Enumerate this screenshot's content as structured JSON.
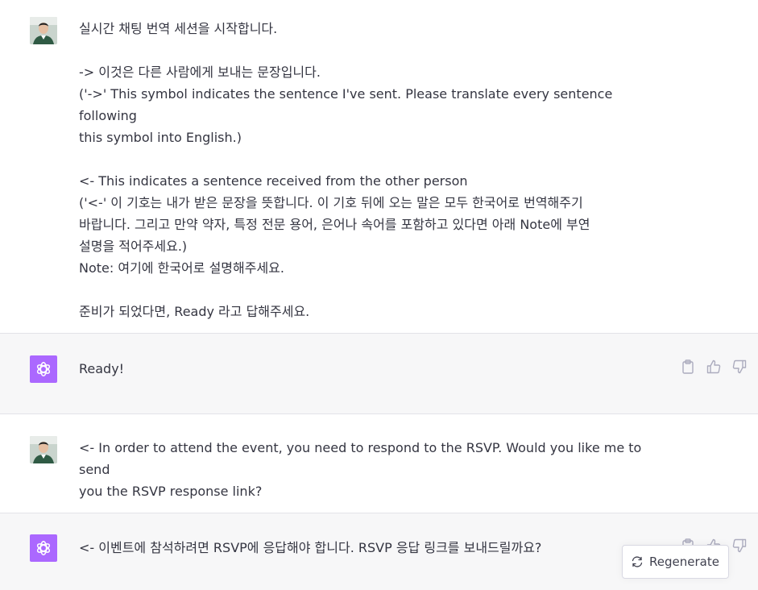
{
  "messages": [
    {
      "role": "user",
      "lines": [
        "실시간 채팅 번역 세션을 시작합니다.",
        "",
        "-> 이것은 다른 사람에게 보내는 문장입니다.",
        "('->'  This symbol indicates the sentence I've sent. Please translate every sentence following",
        "this symbol into English.)",
        "",
        "<- This indicates a sentence received from the other person",
        "('<-' 이 기호는 내가 받은 문장을 뜻합니다. 이 기호 뒤에 오는 말은 모두 한국어로 번역해주기",
        "바랍니다. 그리고 만약 약자, 특정 전문 용어, 은어나 속어를 포함하고 있다면 아래 Note에 부연",
        "설명을 적어주세요.)",
        "Note: 여기에 한국어로 설명해주세요.",
        "",
        "준비가 되었다면, Ready 라고 답해주세요."
      ]
    },
    {
      "role": "assistant",
      "lines": [
        "Ready!"
      ]
    },
    {
      "role": "user",
      "lines": [
        "<- In order to attend the event, you need to respond to the RSVP. Would you like me to send",
        "you the RSVP response link?"
      ]
    },
    {
      "role": "assistant",
      "lines": [
        "<- 이벤트에 참석하려면 RSVP에 응답해야 합니다. RSVP 응답 링크를 보내드릴까요?"
      ]
    }
  ],
  "actions": {
    "copy_icon": "clipboard-icon",
    "like_icon": "thumbs-up-icon",
    "dislike_icon": "thumbs-down-icon"
  },
  "regenerate": {
    "label": "Regenerate",
    "icon": "refresh-icon"
  },
  "colors": {
    "gpt_avatar": "#ab68ff",
    "assistant_bg": "#f7f7f8",
    "text": "#343541"
  }
}
